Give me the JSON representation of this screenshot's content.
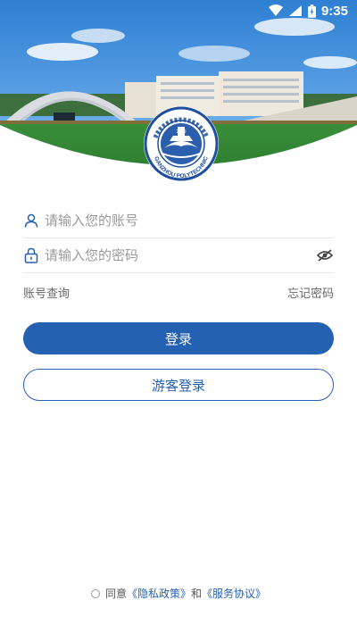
{
  "status": {
    "time": "9:35"
  },
  "login": {
    "account_placeholder": "请输入您的账号",
    "password_placeholder": "请输入您的密码",
    "account_lookup": "账号查询",
    "forgot_password": "忘记密码",
    "login_button": "登录",
    "guest_button": "游客登录"
  },
  "agreement": {
    "prefix": "同意",
    "privacy": "《隐私政策》",
    "and": "和",
    "terms": "《服务协议》"
  },
  "logo": {
    "year": "2019",
    "seal_name": "GANZHOU POLYTECHNIC"
  },
  "colors": {
    "primary": "#2561b2"
  }
}
